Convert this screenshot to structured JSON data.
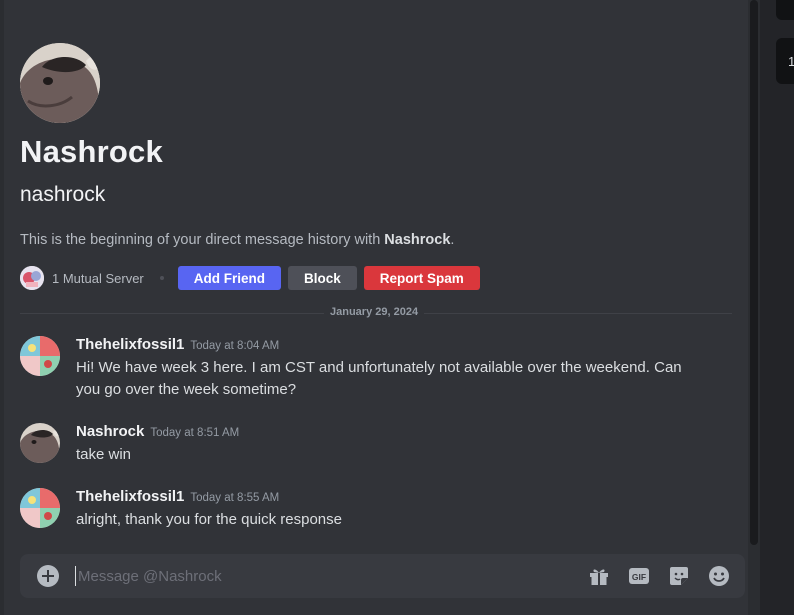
{
  "profile": {
    "display_name": "Nashrock",
    "username": "nashrock",
    "intro_prefix": "This is the beginning of your direct message history with ",
    "intro_name": "Nashrock",
    "intro_suffix": "."
  },
  "actions": {
    "mutual_servers": "1 Mutual Server",
    "add_friend": "Add Friend",
    "block": "Block",
    "report_spam": "Report Spam"
  },
  "date_divider": "January 29, 2024",
  "messages": [
    {
      "author": "Thehelixfossil1",
      "time": "Today at 8:04 AM",
      "text": "Hi! We have week 3 here. I am CST and unfortunately not available over the weekend. Can you go over the week sometime?"
    },
    {
      "author": "Nashrock",
      "time": "Today at 8:51 AM",
      "text": "take win"
    },
    {
      "author": "Thehelixfossil1",
      "time": "Today at 8:55 AM",
      "text": "alright, thank you for the quick response"
    }
  ],
  "composer": {
    "placeholder": "Message @Nashrock",
    "icons": [
      "plus-icon",
      "gift-icon",
      "gif-icon",
      "sticker-icon",
      "emoji-icon"
    ]
  },
  "right_panel": {
    "count": "1"
  },
  "colors": {
    "primary": "#5865f2",
    "danger": "#da373c",
    "secondary": "#4e5058",
    "background": "#313338"
  }
}
